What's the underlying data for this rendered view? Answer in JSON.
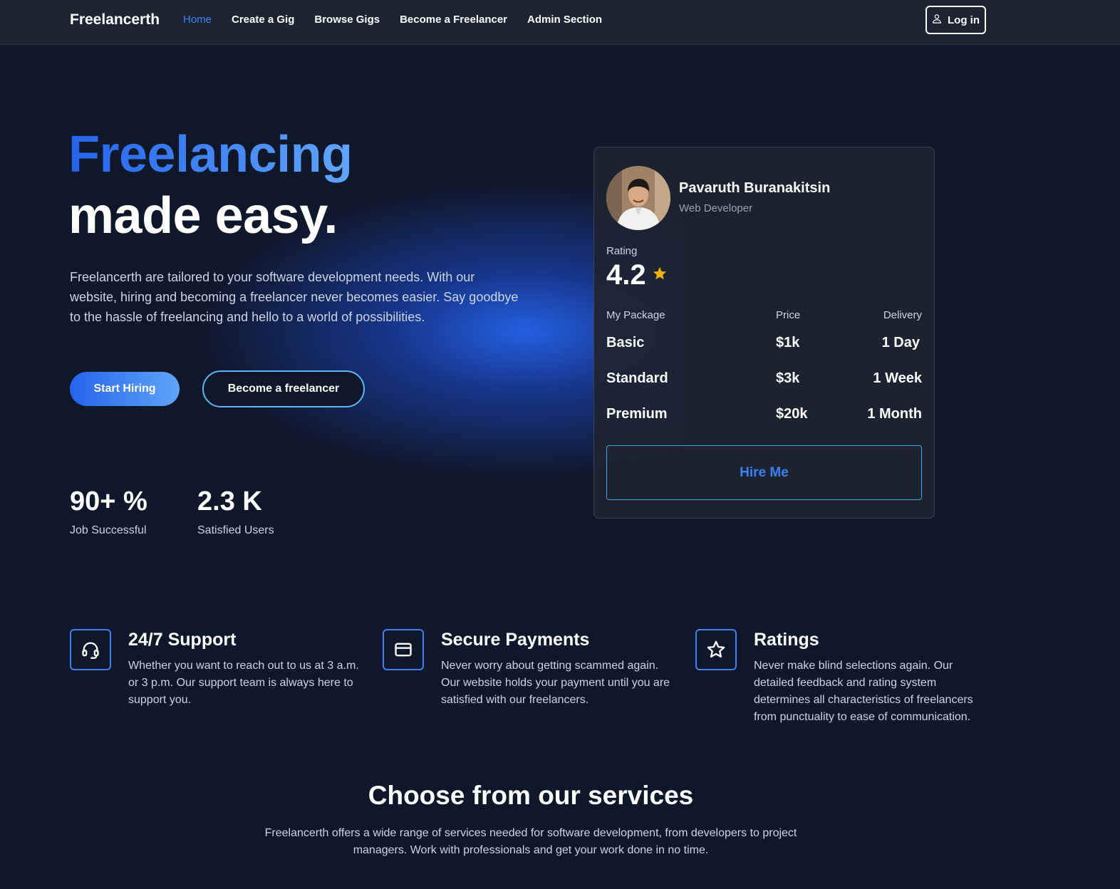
{
  "nav": {
    "brand": "Freelancerth",
    "links": [
      {
        "label": "Home",
        "active": true
      },
      {
        "label": "Create a Gig"
      },
      {
        "label": "Browse Gigs"
      },
      {
        "label": "Become a Freelancer"
      },
      {
        "label": "Admin Section"
      }
    ],
    "login_icon": "user-icon",
    "login_label": "Log in"
  },
  "hero": {
    "title_line1": "Freelancing",
    "title_line2": "made easy.",
    "description": "Freelancerth are tailored to your software development needs. With our website, hiring and becoming a freelancer never becomes easier. Say goodbye to the hassle of freelancing and hello to a world of possibilities.",
    "primary_button": "Start Hiring",
    "secondary_button": "Become a freelancer",
    "stats": [
      {
        "value": "90+ %",
        "label": "Job Successful"
      },
      {
        "value": "2.3 K",
        "label": "Satisfied Users"
      }
    ]
  },
  "profile_card": {
    "name": "Pavaruth Buranakitsin",
    "role": "Web Developer",
    "rating_label": "Rating",
    "rating_value": "4.2",
    "rating_icon": "star-icon",
    "headers": {
      "package": "My Package",
      "price": "Price",
      "delivery": "Delivery"
    },
    "packages": [
      {
        "name": "Basic",
        "price": "$1k",
        "delivery": "1 Day"
      },
      {
        "name": "Standard",
        "price": "$3k",
        "delivery": "1 Week"
      },
      {
        "name": "Premium",
        "price": "$20k",
        "delivery": "1 Month"
      }
    ],
    "hire_button": "Hire Me"
  },
  "features": [
    {
      "icon": "headset-icon",
      "title": "24/7 Support",
      "description": "Whether you want to reach out to us at 3 a.m. or 3 p.m. Our support team is always here to support you."
    },
    {
      "icon": "credit-card-icon",
      "title": "Secure Payments",
      "description": "Never worry about getting scammed again. Our website holds your payment until you are satisfied with our freelancers."
    },
    {
      "icon": "star-outline-icon",
      "title": "Ratings",
      "description": "Never make blind selections again. Our detailed feedback and rating system determines all characteristics of freelancers from punctuality to ease of communication."
    }
  ],
  "services": {
    "title": "Choose from our services",
    "description": "Freelancerth offers a wide range of services needed for software development, from developers to project managers. Work with professionals and get your work done in no time."
  },
  "colors": {
    "background": "#0f172a",
    "nav_background": "#1e2432",
    "accent": "#3b82f6",
    "accent_light": "#60a5fa",
    "star": "#eab308",
    "border_cyan": "#3aa4e6"
  }
}
